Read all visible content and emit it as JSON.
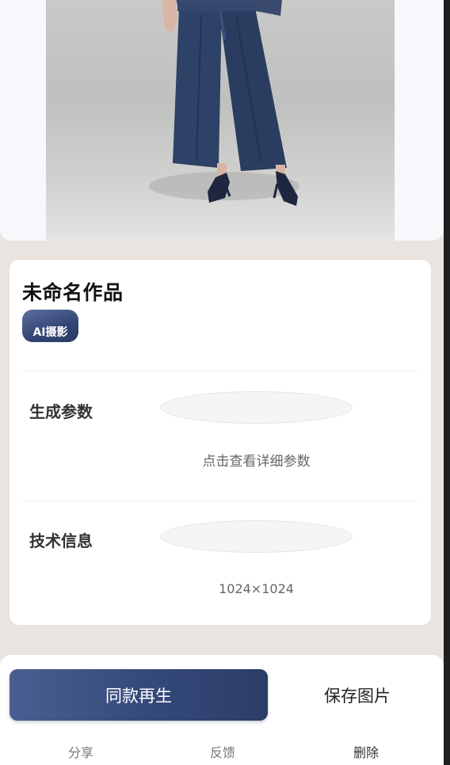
{
  "artwork": {
    "title": "未命名作品",
    "tag": "AI摄影"
  },
  "sections": {
    "generation": {
      "label": "生成参数",
      "value": "点击查看详细参数"
    },
    "tech": {
      "label": "技术信息",
      "value": "1024×1024"
    }
  },
  "actions": {
    "regenerate_label": "同款再生",
    "save_label": "保存图片",
    "share_label": "分享",
    "feedback_label": "反馈",
    "delete_label": "删除"
  },
  "colors": {
    "accent": "#34497a",
    "background": "#e9e4e0"
  }
}
